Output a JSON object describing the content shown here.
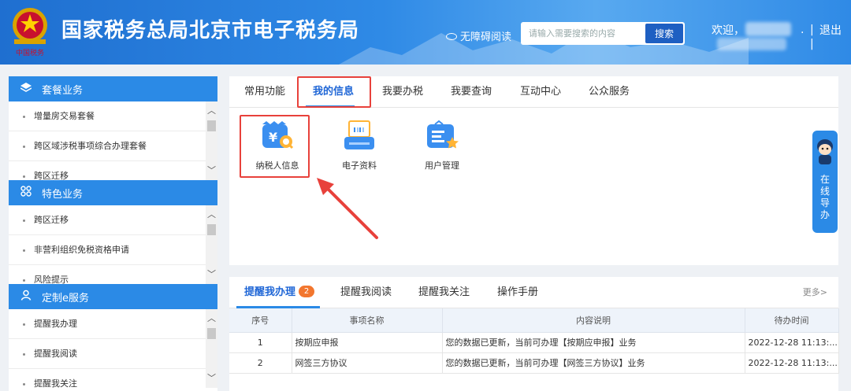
{
  "header": {
    "site_title": "国家税务总局北京市电子税务局",
    "accessible_label": "无障碍阅读",
    "search_placeholder": "请输入需要搜索的内容",
    "search_button": "搜索",
    "welcome": "欢迎，",
    "separator": "|",
    "logout": "退出"
  },
  "sidebar": {
    "groups": [
      {
        "title": "套餐业务",
        "icon": "layers-icon",
        "items": [
          "增量房交易套餐",
          "跨区域涉税事项综合办理套餐",
          "跨区迁移"
        ]
      },
      {
        "title": "特色业务",
        "icon": "grid-icon",
        "items": [
          "跨区迁移",
          "非营利组织免税资格申请",
          "风险提示"
        ]
      },
      {
        "title": "定制e服务",
        "icon": "user-icon",
        "items": [
          "提醒我办理",
          "提醒我阅读",
          "提醒我关注"
        ]
      }
    ]
  },
  "main": {
    "tabs": [
      "常用功能",
      "我的信息",
      "我要办税",
      "我要查询",
      "互动中心",
      "公众服务"
    ],
    "active_tab": "我的信息",
    "functions": [
      {
        "label": "纳税人信息",
        "icon": "taxpayer-info-icon"
      },
      {
        "label": "电子资料",
        "icon": "e-document-icon"
      },
      {
        "label": "用户管理",
        "icon": "user-management-icon"
      }
    ]
  },
  "online_guide": {
    "label": "在线导办"
  },
  "reminders": {
    "tabs": [
      {
        "label": "提醒我办理",
        "badge": "2"
      },
      {
        "label": "提醒我阅读"
      },
      {
        "label": "提醒我关注"
      },
      {
        "label": "操作手册"
      }
    ],
    "more": "更多>",
    "columns": [
      "序号",
      "事项名称",
      "内容说明",
      "待办时间"
    ],
    "rows": [
      [
        "1",
        "按期应申报",
        "您的数据已更新，当前可办理【按期应申报】业务",
        "2022-12-28 11:13:..."
      ],
      [
        "2",
        "网签三方协议",
        "您的数据已更新，当前可办理【网签三方协议】业务",
        "2022-12-28 11:13:..."
      ]
    ]
  },
  "colors": {
    "header_blue": "#2b8ae6",
    "accent_blue": "#1f66d6",
    "highlight_red": "#e8413b",
    "badge_orange": "#f2762e"
  }
}
